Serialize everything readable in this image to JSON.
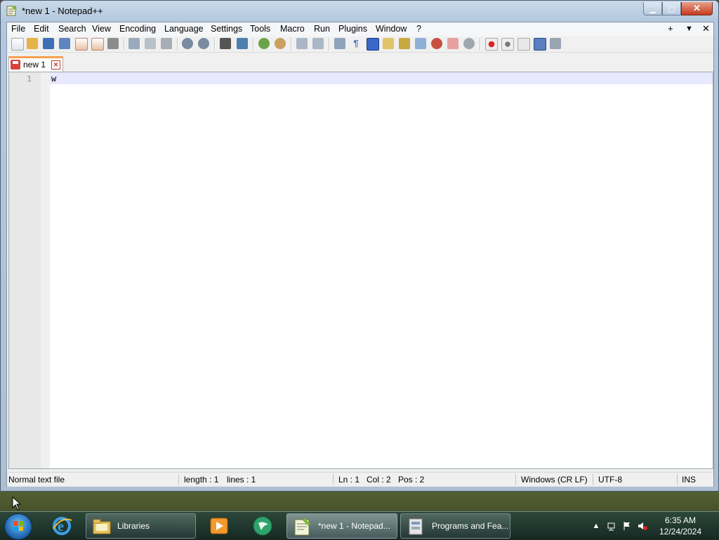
{
  "window": {
    "title": "*new 1 - Notepad++"
  },
  "menu": {
    "items": [
      "File",
      "Edit",
      "Search",
      "View",
      "Encoding",
      "Language",
      "Settings",
      "Tools",
      "Macro",
      "Run",
      "Plugins",
      "Window",
      "?"
    ],
    "right": {
      "add": "+",
      "dropdown": "▼",
      "close": "✕"
    }
  },
  "tab": {
    "label": "new 1"
  },
  "editor": {
    "line_number": "1",
    "content": "w"
  },
  "status": {
    "file_type": "Normal text file",
    "length": "length : 1",
    "lines": "lines : 1",
    "ln": "Ln : 1",
    "col": "Col : 2",
    "pos": "Pos : 2",
    "eol": "Windows (CR LF)",
    "encoding": "UTF-8",
    "mode": "INS"
  },
  "taskbar": {
    "tasks": [
      {
        "label": "Libraries"
      },
      {
        "label": "*new 1 - Notepad..."
      },
      {
        "label": "Programs and Fea..."
      }
    ],
    "clock": {
      "time": "6:35 AM",
      "date": "12/24/2024"
    }
  },
  "colors": {
    "accent_tab": "#f6a04d",
    "current_line": "#e8e8ff"
  }
}
